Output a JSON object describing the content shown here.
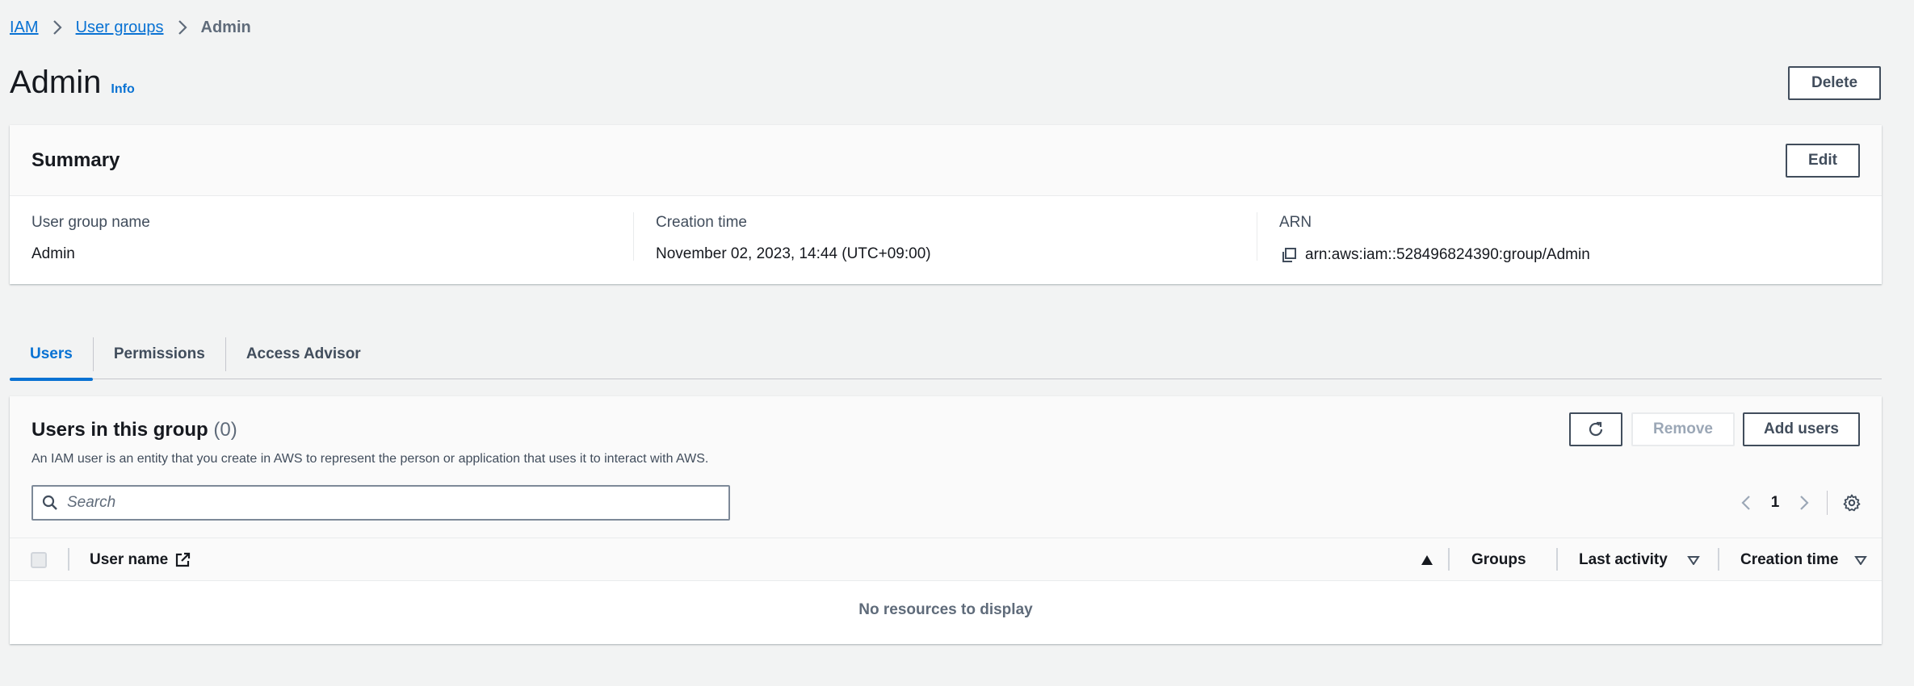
{
  "breadcrumb": {
    "items": [
      "IAM",
      "User groups"
    ],
    "current": "Admin"
  },
  "header": {
    "title": "Admin",
    "info": "Info",
    "delete_label": "Delete"
  },
  "summary": {
    "title": "Summary",
    "edit_label": "Edit",
    "fields": [
      {
        "label": "User group name",
        "value": "Admin"
      },
      {
        "label": "Creation time",
        "value": "November 02, 2023, 14:44 (UTC+09:00)"
      },
      {
        "label": "ARN",
        "value": "arn:aws:iam::528496824390:group/Admin"
      }
    ]
  },
  "tabs": [
    "Users",
    "Permissions",
    "Access Advisor"
  ],
  "users_panel": {
    "title": "Users in this group",
    "count": "(0)",
    "description": "An IAM user is an entity that you create in AWS to represent the person or application that uses it to interact with AWS.",
    "remove_label": "Remove",
    "add_label": "Add users",
    "search_placeholder": "Search",
    "page": "1",
    "columns": [
      "User name",
      "Groups",
      "Last activity",
      "Creation time"
    ],
    "empty_message": "No resources to display"
  },
  "colors": {
    "accent": "#0972d3",
    "background": "#f2f3f3"
  },
  "icons": [
    "chevron-right-icon",
    "copy-icon",
    "refresh-icon",
    "search-icon",
    "chevron-left-icon",
    "settings-gear-icon",
    "external-link-icon",
    "sort-asc-icon",
    "sort-desc-icon"
  ]
}
